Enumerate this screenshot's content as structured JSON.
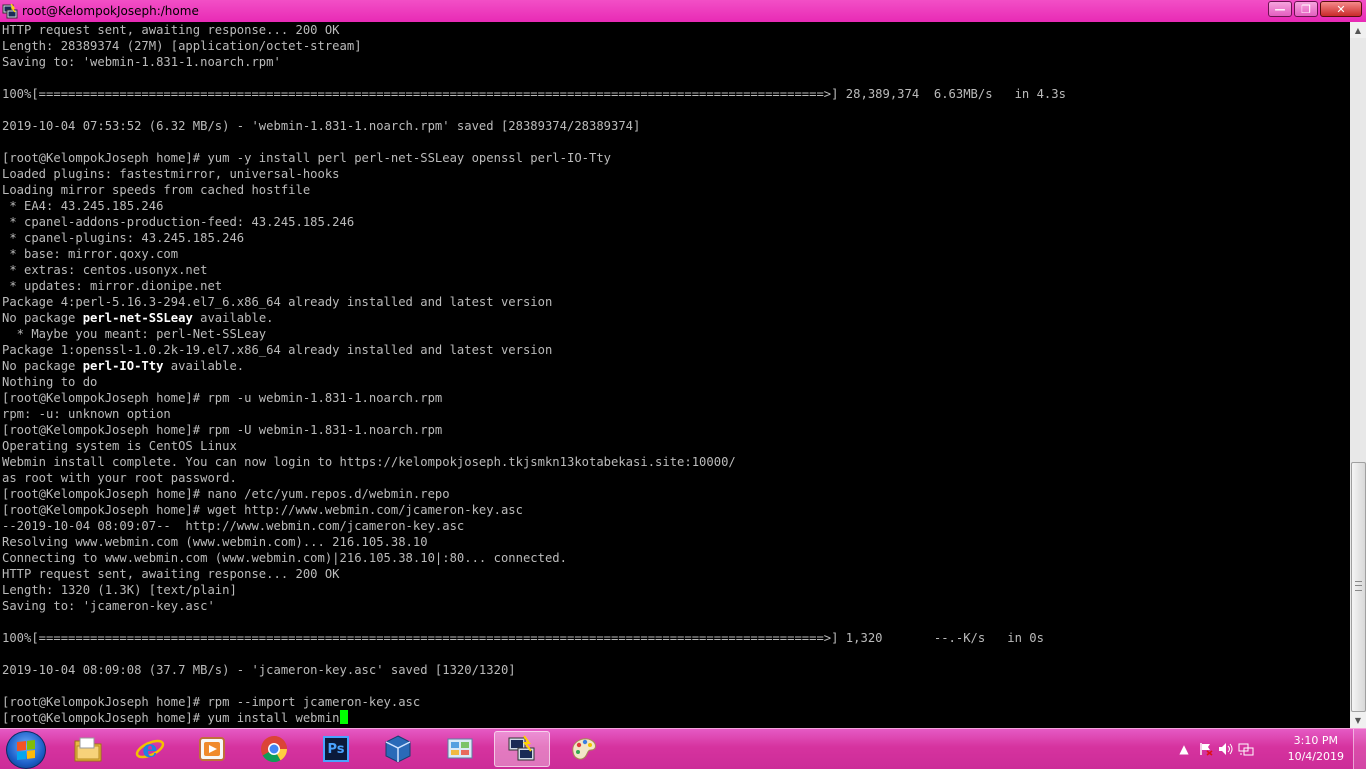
{
  "window": {
    "title": "root@KelompokJoseph:/home",
    "minimize": "—",
    "maximize": "❐",
    "close": "✕"
  },
  "terminal": {
    "lines": [
      "HTTP request sent, awaiting response... 200 OK",
      "Length: 28389374 (27M) [application/octet-stream]",
      "Saving to: 'webmin-1.831-1.noarch.rpm'",
      "",
      "100%[===========================================================================================================>] 28,389,374  6.63MB/s   in 4.3s",
      "",
      "2019-10-04 07:53:52 (6.32 MB/s) - 'webmin-1.831-1.noarch.rpm' saved [28389374/28389374]",
      "",
      "[root@KelompokJoseph home]# yum -y install perl perl-net-SSLeay openssl perl-IO-Tty",
      "Loaded plugins: fastestmirror, universal-hooks",
      "Loading mirror speeds from cached hostfile",
      " * EA4: 43.245.185.246",
      " * cpanel-addons-production-feed: 43.245.185.246",
      " * cpanel-plugins: 43.245.185.246",
      " * base: mirror.qoxy.com",
      " * extras: centos.usonyx.net",
      " * updates: mirror.dionipe.net",
      "Package 4:perl-5.16.3-294.el7_6.x86_64 already installed and latest version",
      {
        "pre": "No package ",
        "bold": "perl-net-SSLeay",
        "post": " available."
      },
      "  * Maybe you meant: perl-Net-SSLeay",
      "Package 1:openssl-1.0.2k-19.el7.x86_64 already installed and latest version",
      {
        "pre": "No package ",
        "bold": "perl-IO-Tty",
        "post": " available."
      },
      "Nothing to do",
      "[root@KelompokJoseph home]# rpm -u webmin-1.831-1.noarch.rpm",
      "rpm: -u: unknown option",
      "[root@KelompokJoseph home]# rpm -U webmin-1.831-1.noarch.rpm",
      "Operating system is CentOS Linux",
      "Webmin install complete. You can now login to https://kelompokjoseph.tkjsmkn13kotabekasi.site:10000/",
      "as root with your root password.",
      "[root@KelompokJoseph home]# nano /etc/yum.repos.d/webmin.repo",
      "[root@KelompokJoseph home]# wget http://www.webmin.com/jcameron-key.asc",
      "--2019-10-04 08:09:07--  http://www.webmin.com/jcameron-key.asc",
      "Resolving www.webmin.com (www.webmin.com)... 216.105.38.10",
      "Connecting to www.webmin.com (www.webmin.com)|216.105.38.10|:80... connected.",
      "HTTP request sent, awaiting response... 200 OK",
      "Length: 1320 (1.3K) [text/plain]",
      "Saving to: 'jcameron-key.asc'",
      "",
      "100%[===========================================================================================================>] 1,320       --.-K/s   in 0s",
      "",
      "2019-10-04 08:09:08 (37.7 MB/s) - 'jcameron-key.asc' saved [1320/1320]",
      "",
      "[root@KelompokJoseph home]# rpm --import jcameron-key.asc",
      {
        "pre": "[root@KelompokJoseph home]# yum install webmin",
        "cursor": true
      }
    ],
    "colors": {
      "text": "#bbbbbb",
      "bold": "#ffffff",
      "cursor": "#00ff00",
      "background": "#000000"
    }
  },
  "taskbar": {
    "color": "#d6339f",
    "items": [
      {
        "name": "file-explorer-icon"
      },
      {
        "name": "internet-explorer-icon"
      },
      {
        "name": "media-player-icon"
      },
      {
        "name": "chrome-icon"
      },
      {
        "name": "photoshop-icon",
        "text": "Ps"
      },
      {
        "name": "virtualbox-icon"
      },
      {
        "name": "control-panel-icon"
      },
      {
        "name": "putty-icon",
        "active": true
      },
      {
        "name": "paint-icon"
      }
    ],
    "clock": {
      "time": "3:10 PM",
      "date": "10/4/2019"
    }
  }
}
